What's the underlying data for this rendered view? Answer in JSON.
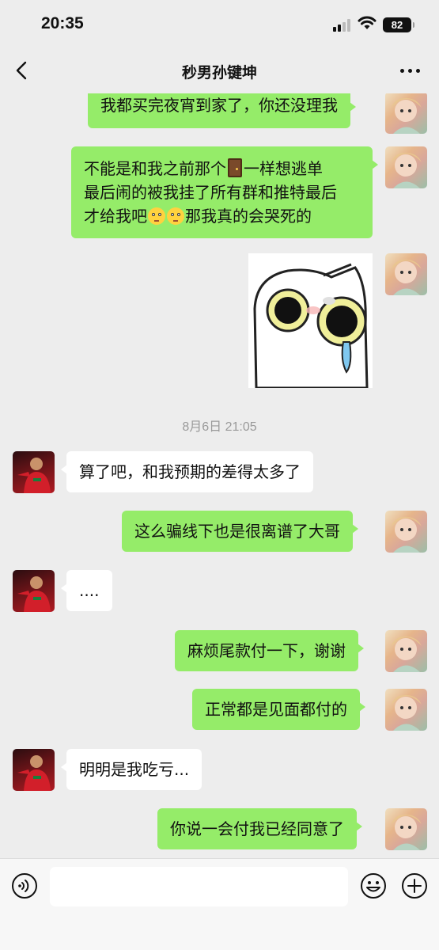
{
  "status_bar": {
    "time": "20:35",
    "battery": "82"
  },
  "header": {
    "title": "秒男孙键坤"
  },
  "messages": [
    {
      "side": "me",
      "text": "我都买完夜宵到家了，你还没理我"
    },
    {
      "side": "me",
      "line1_pre": "不能是和我之前那个",
      "line1_post": "一样想逃单",
      "line2": "最后闹的被我挂了所有群和推特最后",
      "line3_pre": "才给我吧",
      "line3_post": "那我真的会哭死的",
      "emojis": [
        "door-emoji",
        "flushed-face-emoji"
      ]
    },
    {
      "side": "me",
      "type": "sticker",
      "icon": "cat-sticker"
    },
    {
      "type": "timestamp",
      "text": "8月6日 21:05"
    },
    {
      "side": "other",
      "text": "算了吧，和我预期的差得太多了"
    },
    {
      "side": "me",
      "text": "这么骗线下也是很离谱了大哥"
    },
    {
      "side": "other",
      "text": "...."
    },
    {
      "side": "me",
      "text": "麻烦尾款付一下，谢谢"
    },
    {
      "side": "me",
      "text": "正常都是见面都付的"
    },
    {
      "side": "other",
      "text": "明明是我吃亏..."
    },
    {
      "side": "me",
      "text": "你说一会付我已经同意了"
    }
  ],
  "input": {
    "placeholder": ""
  },
  "colors": {
    "my_bubble": "#95ec69",
    "other_bubble": "#ffffff",
    "background": "#ededed"
  }
}
